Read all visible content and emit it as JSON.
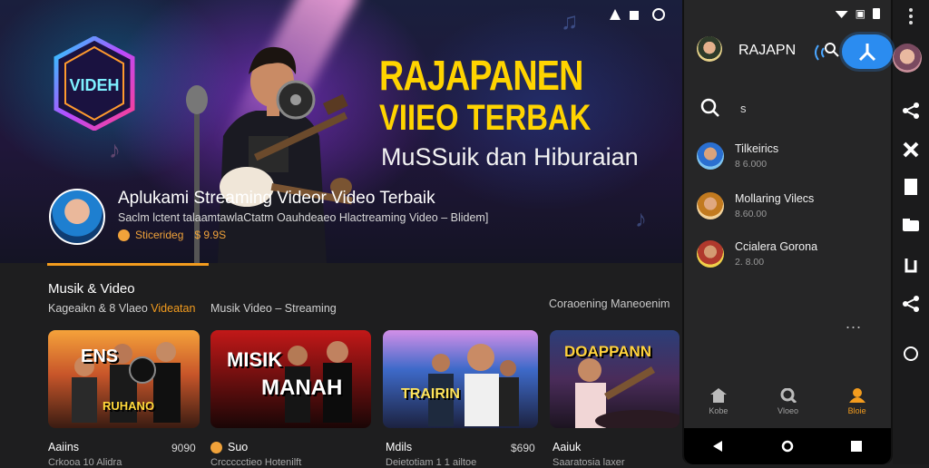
{
  "hero": {
    "title_line1": "RAJAPANEN",
    "title_line2": "VIIEO TERBAK",
    "subtitle": "MuSSuik dan Hiburaian",
    "logo_text": "VIDEH",
    "app_title": "Aplukami Streaming Videor Video Terbaik",
    "app_desc": "Saclm lctent talaamtawlaCtatm Oauhdeaeo Hlactreaming Video – Blidem]",
    "meta_left": "Sticerideg",
    "meta_right": "$ 9.9S"
  },
  "section": {
    "title": "Musik & Video",
    "sub_prefix": "Kageaikn & 8 Vlaeo",
    "sub_highlight": "Videatan",
    "sub2": "Musik Video – Streaming",
    "right_label": "Coraoening Maneoenim"
  },
  "cards": [
    {
      "overlay_top": "ENS",
      "overlay_bottom": "RUHANO",
      "label": "Aaiins",
      "num": "9090",
      "meta": "Crkooa 10 Alidra"
    },
    {
      "overlay_top": "MISIK",
      "overlay_bottom": "MANAH",
      "label": "Suo",
      "num": "",
      "meta": "Crccccctieo Hotenilft"
    },
    {
      "overlay_top": "",
      "overlay_bottom": "TRAIRIN",
      "label": "Mdils",
      "num": "$690",
      "meta": "Deietotiam 1 1 ailtoe"
    },
    {
      "overlay_top": "DOAPPANN",
      "overlay_bottom": "",
      "label": "Aaiuk",
      "num": "",
      "meta": "Saaratosia laxer"
    }
  ],
  "phone": {
    "user_name": "RAJAPN",
    "search_query": "s",
    "chats": [
      {
        "name": "Tilkeirics",
        "sub": "8 6.000"
      },
      {
        "name": "Mollaring Vilecs",
        "sub": "8.60.00"
      },
      {
        "name": "Ccialera Gorona",
        "sub": "2. 8.00"
      }
    ],
    "more": "...",
    "nav": [
      {
        "icon": "home-icon",
        "label": "Kobe"
      },
      {
        "icon": "search-icon",
        "label": "Vloeo"
      },
      {
        "icon": "profile-icon",
        "label": "Bloie"
      }
    ]
  },
  "colors": {
    "accent": "#f39c1e",
    "hero_title": "#ffd400",
    "fab": "#2b8cf0"
  }
}
